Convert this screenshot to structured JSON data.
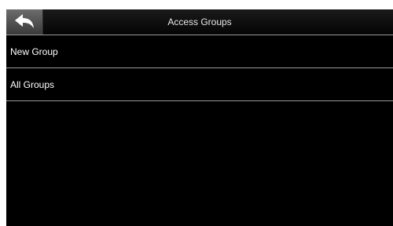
{
  "header": {
    "title": "Access Groups",
    "back_icon": "back-arrow-icon"
  },
  "menu": {
    "items": [
      {
        "label": "New Group"
      },
      {
        "label": "All Groups"
      }
    ]
  },
  "colors": {
    "background": "#000000",
    "divider": "#9a9a9a",
    "text": "#ffffff"
  }
}
